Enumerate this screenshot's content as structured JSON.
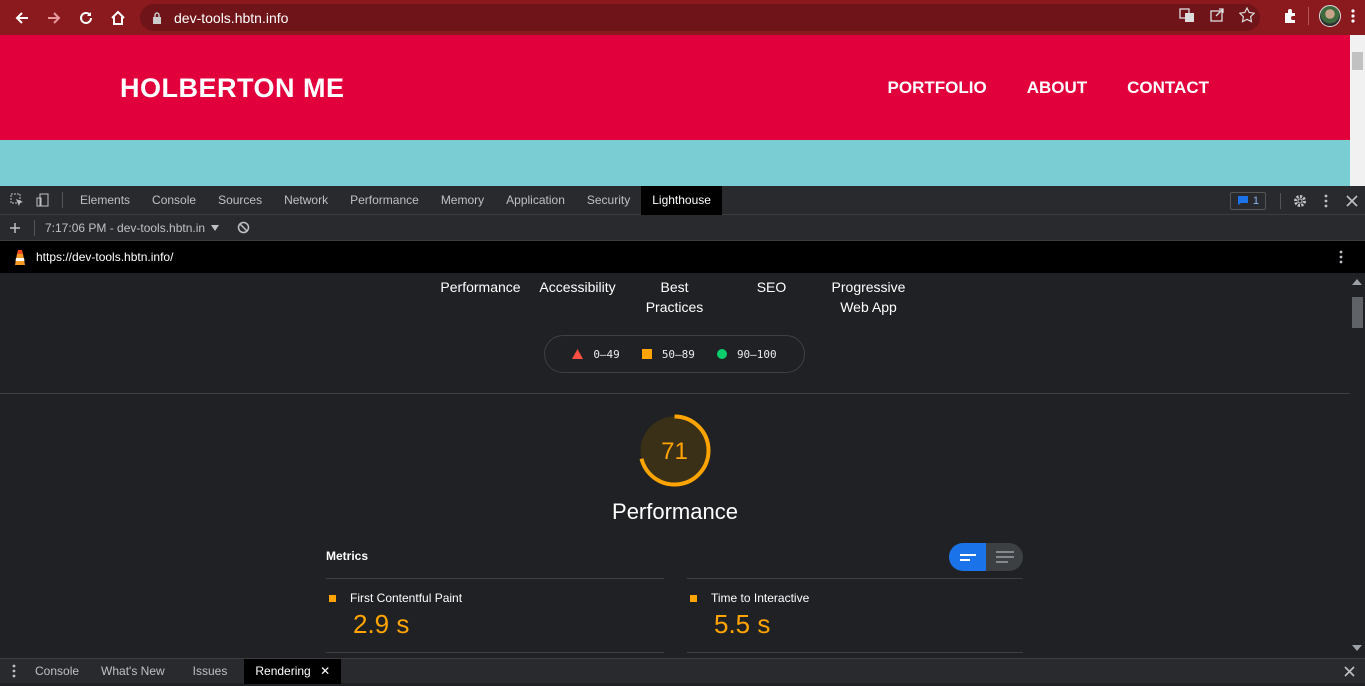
{
  "browser": {
    "url": "dev-tools.hbtn.info"
  },
  "site": {
    "logo": "HOLBERTON ME",
    "nav": [
      "PORTFOLIO",
      "ABOUT",
      "CONTACT"
    ]
  },
  "devtools": {
    "tabs": [
      "Elements",
      "Console",
      "Sources",
      "Network",
      "Performance",
      "Memory",
      "Application",
      "Security",
      "Lighthouse"
    ],
    "active_tab": "Lighthouse",
    "issues_count": "1",
    "report_selector": "7:17:06 PM - dev-tools.hbtn.in",
    "report_url": "https://dev-tools.hbtn.info/"
  },
  "report": {
    "categories": [
      {
        "line1": "Performance",
        "line2": ""
      },
      {
        "line1": "Accessibility",
        "line2": ""
      },
      {
        "line1": "Best",
        "line2": "Practices"
      },
      {
        "line1": "SEO",
        "line2": ""
      },
      {
        "line1": "Progressive",
        "line2": "Web App"
      }
    ],
    "legend": [
      {
        "label": "0–49",
        "color": "#ff4e42",
        "shape": "triangle"
      },
      {
        "label": "50–89",
        "color": "#ffa400",
        "shape": "square"
      },
      {
        "label": "90–100",
        "color": "#0cce6b",
        "shape": "circle"
      }
    ],
    "score": "71",
    "score_value": 0.71,
    "score_color": "#ffa400",
    "score_title": "Performance",
    "metrics_title": "Metrics",
    "metrics": [
      {
        "name": "First Contentful Paint",
        "value": "2.9 s"
      },
      {
        "name": "Time to Interactive",
        "value": "5.5 s"
      }
    ]
  },
  "drawer": {
    "tabs": [
      "Console",
      "What's New",
      "Issues",
      "Rendering"
    ],
    "active": "Rendering"
  }
}
